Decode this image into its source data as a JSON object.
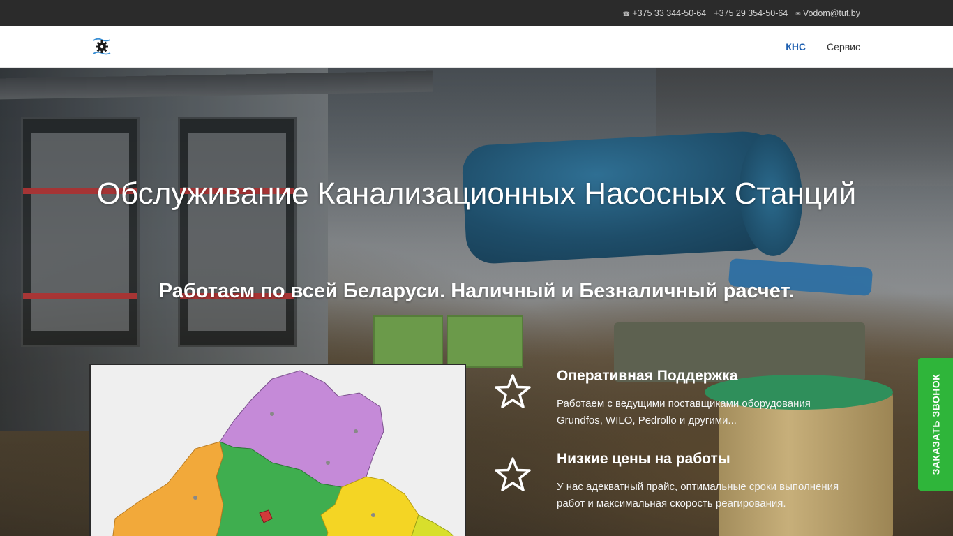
{
  "topbar": {
    "social_icons": [
      "",
      "",
      "",
      "",
      "",
      "",
      "",
      "",
      "",
      "",
      "",
      ""
    ],
    "phone1": "+375 33 344-50-64",
    "phone2": "+375 29 354-50-64",
    "email": "Vodom@tut.by"
  },
  "navbar": {
    "logo_icon": "gear-water-icon",
    "items": [
      {
        "label": "КНС",
        "active": true
      },
      {
        "label": "Сервис",
        "active": false
      }
    ]
  },
  "hero": {
    "title": "Обслуживание Канализационных Насосных Станций",
    "subtitle": "Работаем по всей Беларуси. Наличный и Безналичный расчет."
  },
  "features": [
    {
      "icon": "star-icon",
      "title": "Оперативная Поддержка",
      "text": "Работаем с ведущими поставщиками оборудования Grundfos, WILO, Pedrollo и другими..."
    },
    {
      "icon": "star-icon",
      "title": "Низкие цены на работы",
      "text": "У нас адекватный прайс, оптимальные сроки выполнения работ и максимальная скорость реагирования."
    }
  ],
  "callback": {
    "label": "ЗАКАЗАТЬ ЗВОНОК"
  },
  "colors": {
    "accent": "#1e5fb0",
    "callback": "#2fb53a",
    "topbar": "#2b2b2b"
  }
}
